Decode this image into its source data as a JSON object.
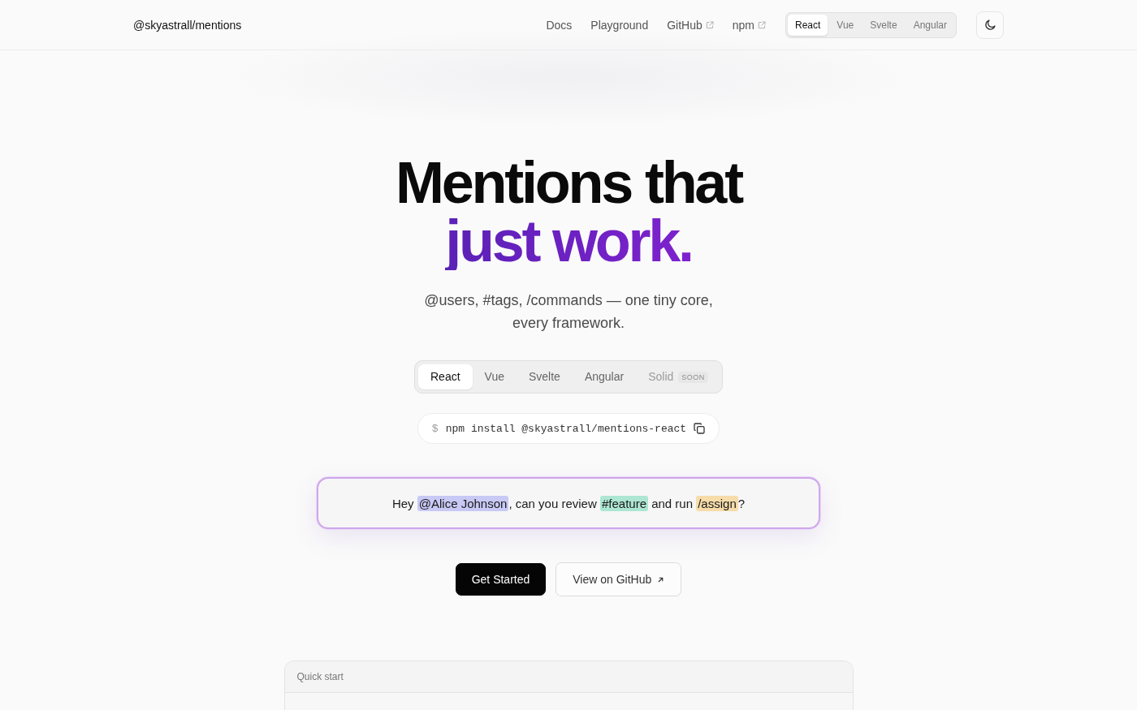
{
  "nav": {
    "logo": "@skyastrall/mentions",
    "links": [
      {
        "label": "Docs",
        "external": false
      },
      {
        "label": "Playground",
        "external": false
      },
      {
        "label": "GitHub",
        "external": true
      },
      {
        "label": "npm",
        "external": true
      }
    ],
    "framework_tabs": [
      {
        "label": "React",
        "selected": true
      },
      {
        "label": "Vue",
        "selected": false
      },
      {
        "label": "Svelte",
        "selected": false
      },
      {
        "label": "Angular",
        "selected": false
      }
    ]
  },
  "hero": {
    "title": "Mentions that",
    "title_accent": "just work.",
    "subtitle": "@users, #tags, /commands — one tiny core, every framework.",
    "framework_tabs": [
      {
        "label": "React",
        "selected": true,
        "disabled": false
      },
      {
        "label": "Vue",
        "selected": false,
        "disabled": false
      },
      {
        "label": "Svelte",
        "selected": false,
        "disabled": false
      },
      {
        "label": "Angular",
        "selected": false,
        "disabled": false
      },
      {
        "label": "Solid",
        "selected": false,
        "disabled": true,
        "badge": "SOON"
      }
    ],
    "install": {
      "prompt": "$",
      "command": "npm install @skyastrall/mentions-react"
    },
    "editor": {
      "segments": [
        {
          "kind": "text",
          "text": "Hey "
        },
        {
          "kind": "mention",
          "text": "@Alice Johnson"
        },
        {
          "kind": "text",
          "text": ", can you review "
        },
        {
          "kind": "tag",
          "text": "#feature"
        },
        {
          "kind": "text",
          "text": " and run "
        },
        {
          "kind": "command",
          "text": "/assign"
        },
        {
          "kind": "text",
          "text": "?"
        }
      ]
    },
    "buttons": [
      {
        "label": "Get Started",
        "kind": "primary",
        "external": false
      },
      {
        "label": "View on GitHub",
        "kind": "secondary",
        "external": true
      }
    ]
  },
  "quick_start": {
    "title": "Quick start"
  }
}
